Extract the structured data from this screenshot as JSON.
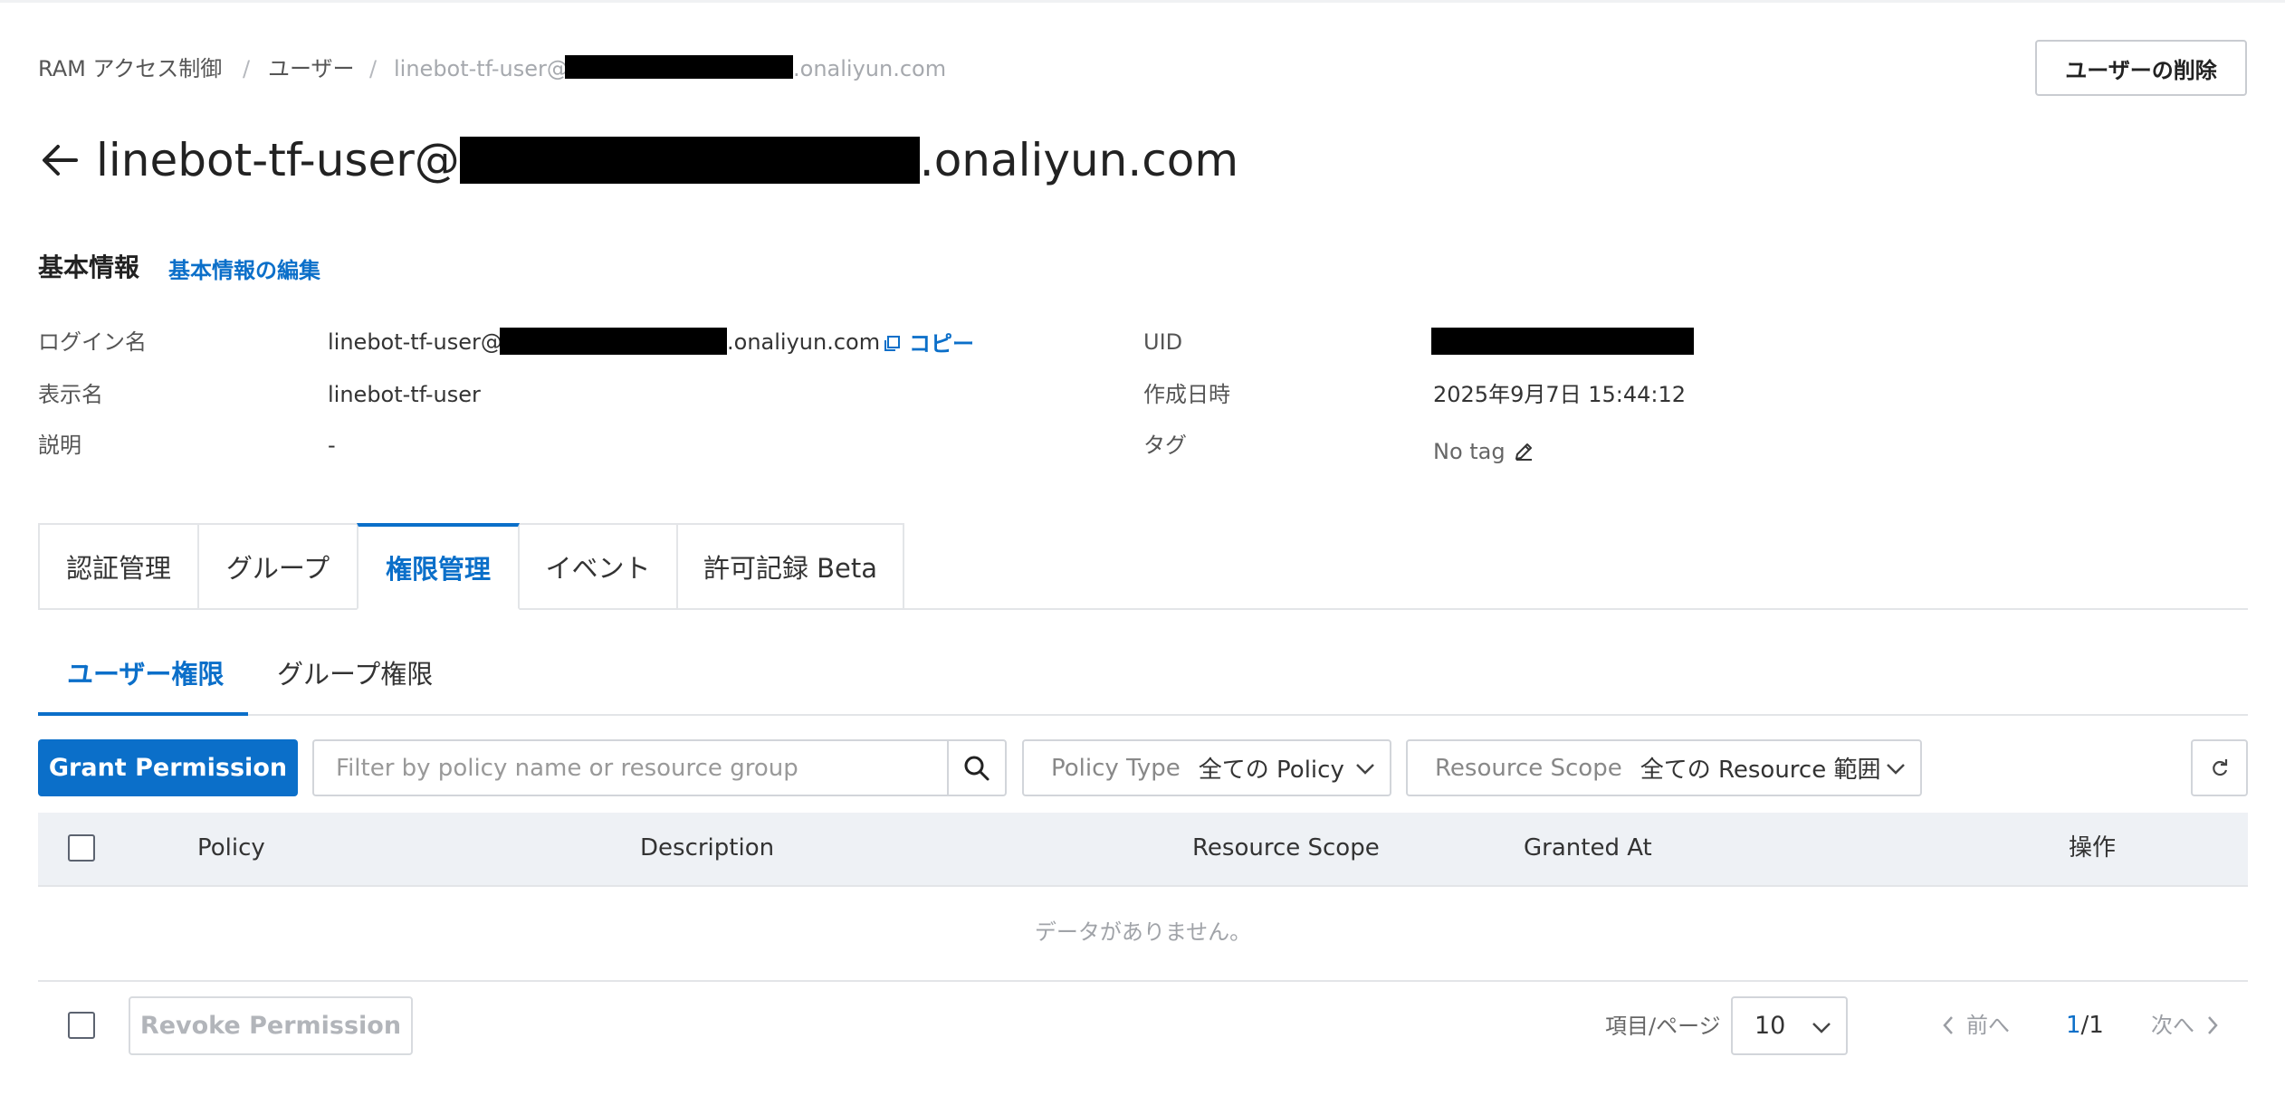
{
  "breadcrumb": {
    "items": [
      "RAM アクセス制御",
      "ユーザー",
      "linebot-tf-user@",
      ".onaliyun.com"
    ],
    "separator": "/"
  },
  "header": {
    "delete_button": "ユーザーの削除",
    "title_prefix": "linebot-tf-user@",
    "title_suffix": ".onaliyun.com",
    "back_icon": "arrow-left-icon"
  },
  "basic_info": {
    "title": "基本情報",
    "edit_link": "基本情報の編集",
    "login_name_label": "ログイン名",
    "login_name_prefix": "linebot-tf-user@",
    "login_name_suffix": ".onaliyun.com",
    "copy_label": "コピー",
    "display_name_label": "表示名",
    "display_name": "linebot-tf-user",
    "description_label": "説明",
    "description": "-",
    "uid_label": "UID",
    "created_label": "作成日時",
    "created_value": "2025年9月7日 15:44:12",
    "tag_label": "タグ",
    "tag_value": "No tag"
  },
  "tabs": [
    {
      "label": "認証管理",
      "active": false
    },
    {
      "label": "グループ",
      "active": false
    },
    {
      "label": "権限管理",
      "active": true
    },
    {
      "label": "イベント",
      "active": false
    },
    {
      "label": "許可記録 Beta",
      "active": false
    }
  ],
  "subtabs": [
    {
      "label": "ユーザー権限",
      "active": true
    },
    {
      "label": "グループ権限",
      "active": false
    }
  ],
  "toolbar": {
    "grant_button": "Grant Permission",
    "search_placeholder": "Filter by policy name or resource group",
    "policy_type_label": "Policy Type",
    "policy_type_value": "全ての Policy",
    "resource_scope_label": "Resource Scope",
    "resource_scope_value": "全ての Resource 範囲"
  },
  "table": {
    "columns": [
      "Policy",
      "Description",
      "Resource Scope",
      "Granted At",
      "操作"
    ],
    "empty_text": "データがありません。"
  },
  "footer": {
    "revoke_button": "Revoke Permission",
    "per_page_label": "項目/ページ",
    "per_page_value": "10",
    "prev_label": "前へ",
    "next_label": "次へ",
    "current_page": "1",
    "total_pages": "/1"
  },
  "colors": {
    "accent": "#0b6fc9",
    "table_header_bg": "#eef1f5",
    "border": "#d2d5da"
  }
}
